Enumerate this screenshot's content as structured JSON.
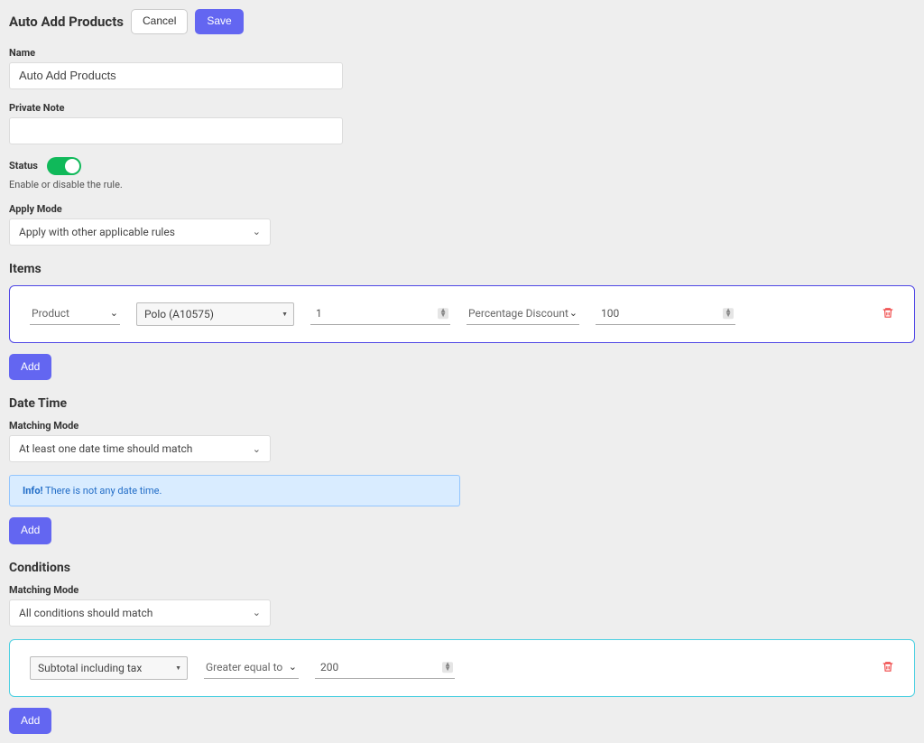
{
  "header": {
    "title": "Auto Add Products",
    "cancel_label": "Cancel",
    "save_label": "Save"
  },
  "name": {
    "label": "Name",
    "value": "Auto Add Products"
  },
  "private_note": {
    "label": "Private Note",
    "value": ""
  },
  "status": {
    "label": "Status",
    "helper": "Enable or disable the rule.",
    "enabled": true
  },
  "apply_mode": {
    "label": "Apply Mode",
    "selected": "Apply with other applicable rules"
  },
  "items": {
    "heading": "Items",
    "rows": [
      {
        "type": "Product",
        "product": "Polo (A10575)",
        "qty": "1",
        "discount_type": "Percentage Discount",
        "discount_value": "100"
      }
    ],
    "add_label": "Add"
  },
  "datetime": {
    "heading": "Date Time",
    "matching_mode_label": "Matching Mode",
    "matching_mode_selected": "At least one date time should match",
    "info_prefix": "Info!",
    "info_text": " There is not any date time.",
    "add_label": "Add"
  },
  "conditions": {
    "heading": "Conditions",
    "matching_mode_label": "Matching Mode",
    "matching_mode_selected": "All conditions should match",
    "rows": [
      {
        "field": "Subtotal including tax",
        "operator": "Greater equal to",
        "value": "200"
      }
    ],
    "add_label": "Add"
  }
}
